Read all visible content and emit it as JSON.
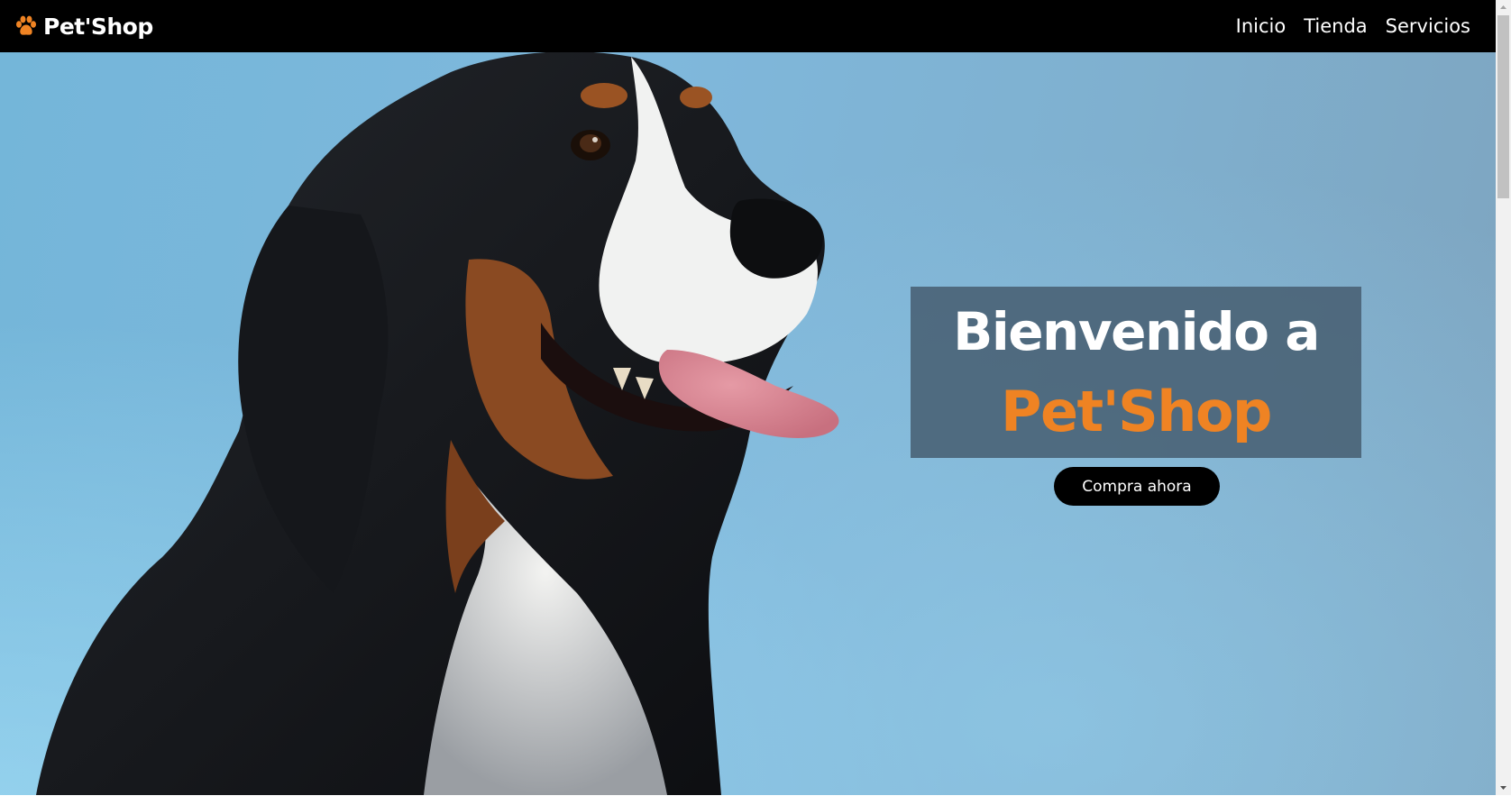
{
  "navbar": {
    "brand_name": "Pet'Shop",
    "brand_icon": "paw-icon",
    "links": [
      "Inicio",
      "Tienda",
      "Servicios"
    ]
  },
  "hero": {
    "image": "dog-photo",
    "welcome_line1": "Bienvenido a",
    "welcome_line2": "Pet'Shop",
    "cta_label": "Compra ahora"
  },
  "colors": {
    "navbar_bg": "#000000",
    "accent_orange": "#ef8323",
    "hero_box_bg": "#486073",
    "hero_sky": "#7fb8dc",
    "button_bg": "#000000",
    "text_light": "#ffffff"
  }
}
